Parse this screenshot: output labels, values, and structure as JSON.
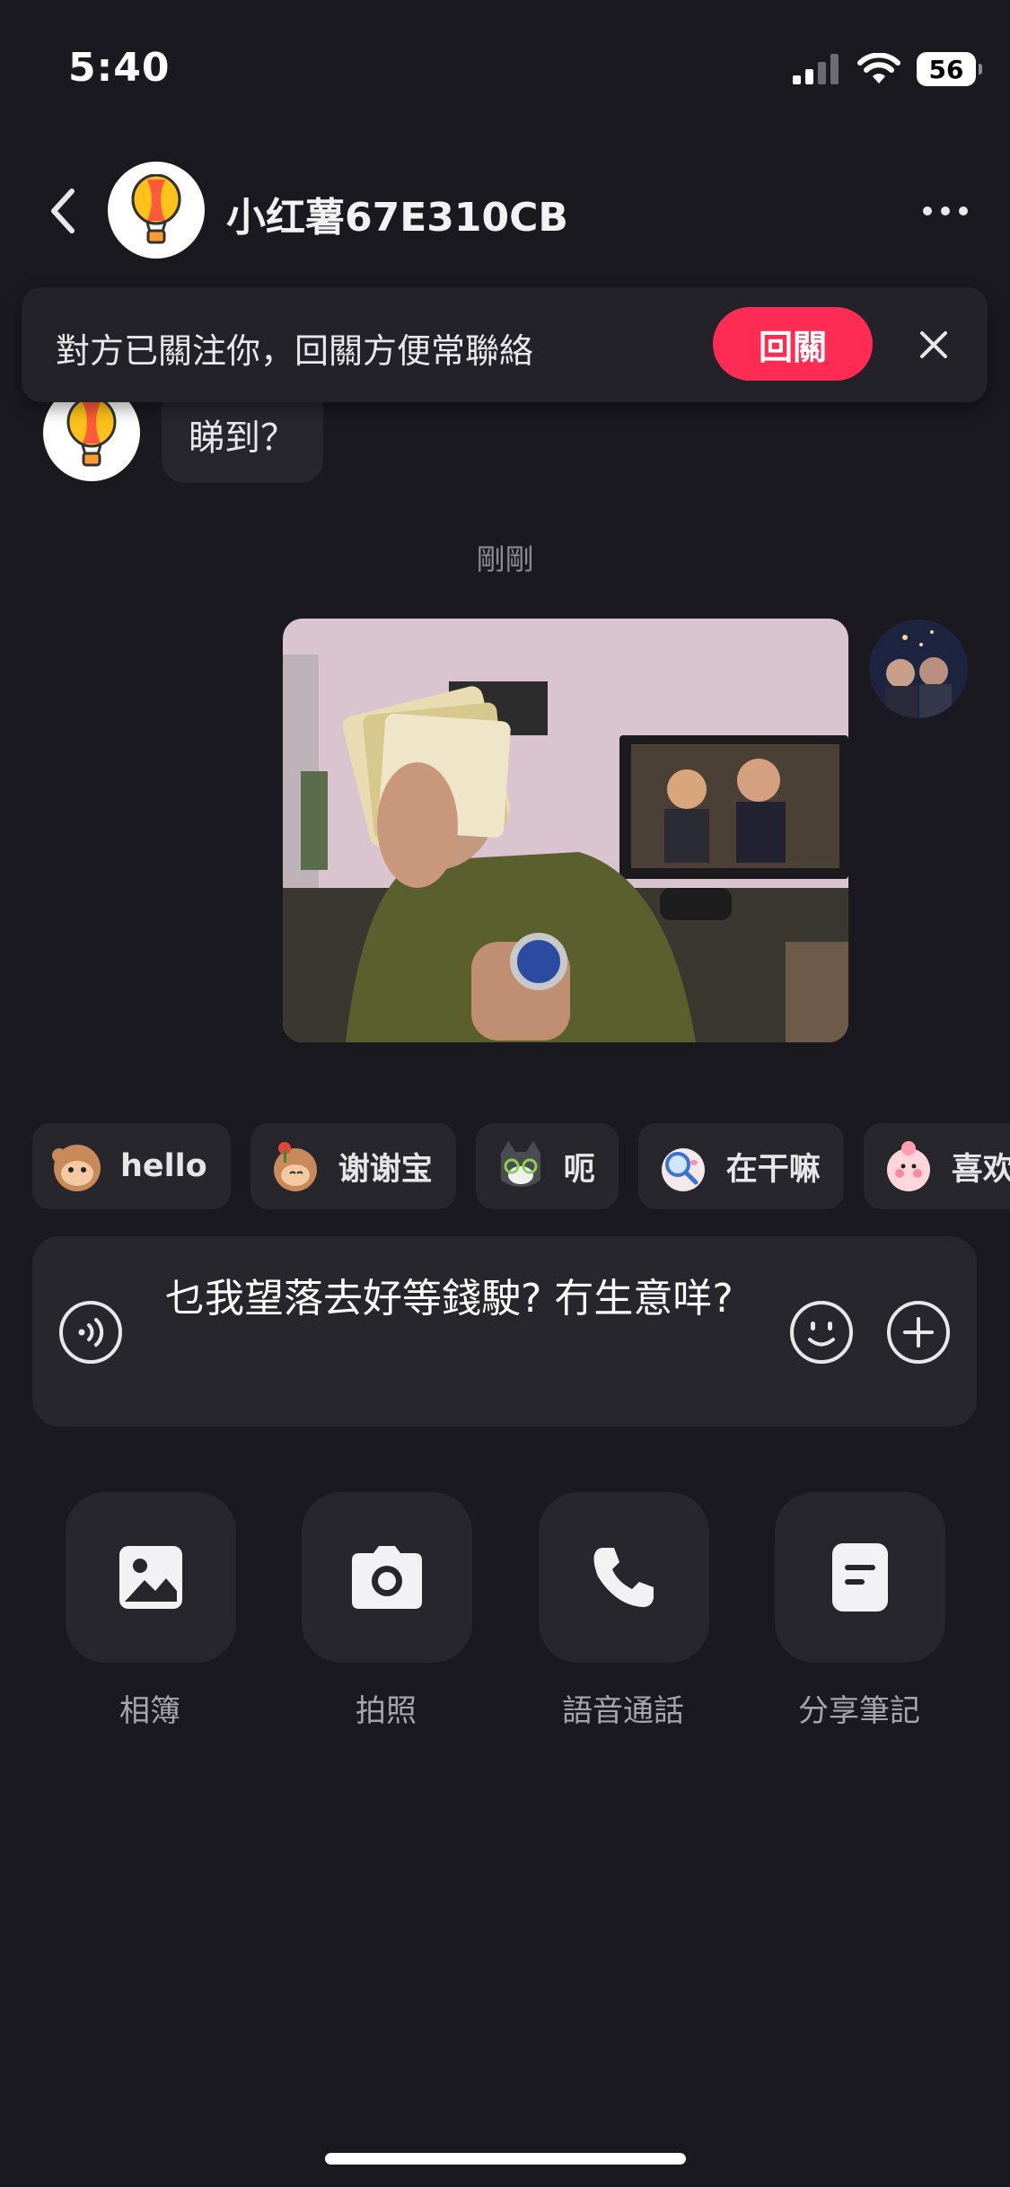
{
  "status_bar": {
    "time": "5:40",
    "battery": "56"
  },
  "header": {
    "title": "小红薯67E310CB"
  },
  "follow_banner": {
    "text": "對方已關注你，回關方便常聯絡",
    "button_label": "回關"
  },
  "messages": {
    "incoming_text": "睇到？",
    "timestamp": "剛剛"
  },
  "stickers": [
    {
      "label": "hello",
      "icon": "monkey-wave-sticker"
    },
    {
      "label": "谢谢宝",
      "icon": "monkey-flower-sticker"
    },
    {
      "label": "呃",
      "icon": "cat-glasses-sticker"
    },
    {
      "label": "在干嘛",
      "icon": "magnifier-sticker"
    },
    {
      "label": "喜欢",
      "icon": "pink-blush-sticker"
    }
  ],
  "composer": {
    "text": "乜我望落去好等錢駛? 冇生意咩?"
  },
  "actions": [
    {
      "label": "相簿",
      "icon": "photo-album-icon"
    },
    {
      "label": "拍照",
      "icon": "camera-icon"
    },
    {
      "label": "語音通話",
      "icon": "phone-icon"
    },
    {
      "label": "分享筆記",
      "icon": "note-icon"
    }
  ],
  "colors": {
    "background": "#19191f",
    "surface": "#26262c",
    "accent": "#fe2c55"
  }
}
